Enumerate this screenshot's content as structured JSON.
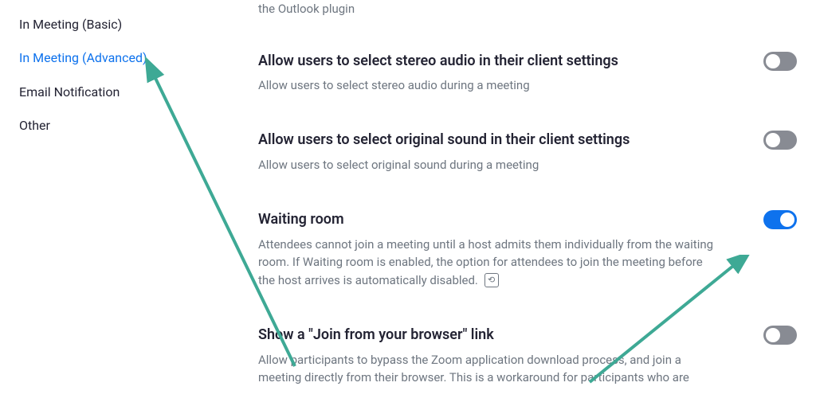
{
  "sidebar": {
    "items": [
      {
        "label": "In Meeting (Basic)",
        "active": false
      },
      {
        "label": "In Meeting (Advanced)",
        "active": true
      },
      {
        "label": "Email Notification",
        "active": false
      },
      {
        "label": "Other",
        "active": false
      }
    ]
  },
  "top_fragment": "the Outlook plugin",
  "settings": [
    {
      "title": "Allow users to select stereo audio in their client settings",
      "description": "Allow users to select stereo audio during a meeting",
      "enabled": false
    },
    {
      "title": "Allow users to select original sound in their client settings",
      "description": "Allow users to select original sound during a meeting",
      "enabled": false
    },
    {
      "title": "Waiting room",
      "description": "Attendees cannot join a meeting until a host admits them individually from the waiting room. If Waiting room is enabled, the option for attendees to join the meeting before the host arrives is automatically disabled.",
      "enabled": true,
      "has_reset": true
    },
    {
      "title": "Show a \"Join from your browser\" link",
      "description": "Allow participants to bypass the Zoom application download process, and join a meeting directly from their browser. This is a workaround for participants who are",
      "enabled": false
    }
  ],
  "annotations": {
    "arrow_color": "#3EA995"
  }
}
